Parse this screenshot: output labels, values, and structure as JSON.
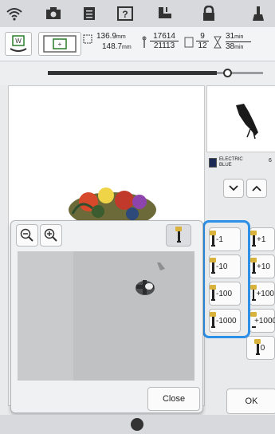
{
  "top_icons": [
    "wifi-icon",
    "camera-icon",
    "document-icon",
    "help-icon",
    "embroidery-foot-icon",
    "lock-icon",
    "presser-foot-icon"
  ],
  "info": {
    "size_width": "136.9",
    "size_height": "148.7",
    "size_unit": "mm",
    "stitch_current": "17614",
    "stitch_total": "21113",
    "color_current": "9",
    "color_total": "12",
    "time_current": "31",
    "time_total": "38",
    "time_unit": "min"
  },
  "thread": {
    "name_line1": "ELECTRIC",
    "name_line2": "BLUE",
    "number": "6",
    "color": "#1b2a55"
  },
  "needle_buttons": [
    {
      "minus": "-1",
      "plus": "+1"
    },
    {
      "minus": "-10",
      "plus": "+10"
    },
    {
      "minus": "-100",
      "plus": "+100"
    },
    {
      "minus": "-1000",
      "plus": "+1000"
    }
  ],
  "needle_zero": "0",
  "popup": {
    "close_label": "Close"
  },
  "ok_label": "OK",
  "colors": {
    "highlight": "#2d8fe6"
  }
}
